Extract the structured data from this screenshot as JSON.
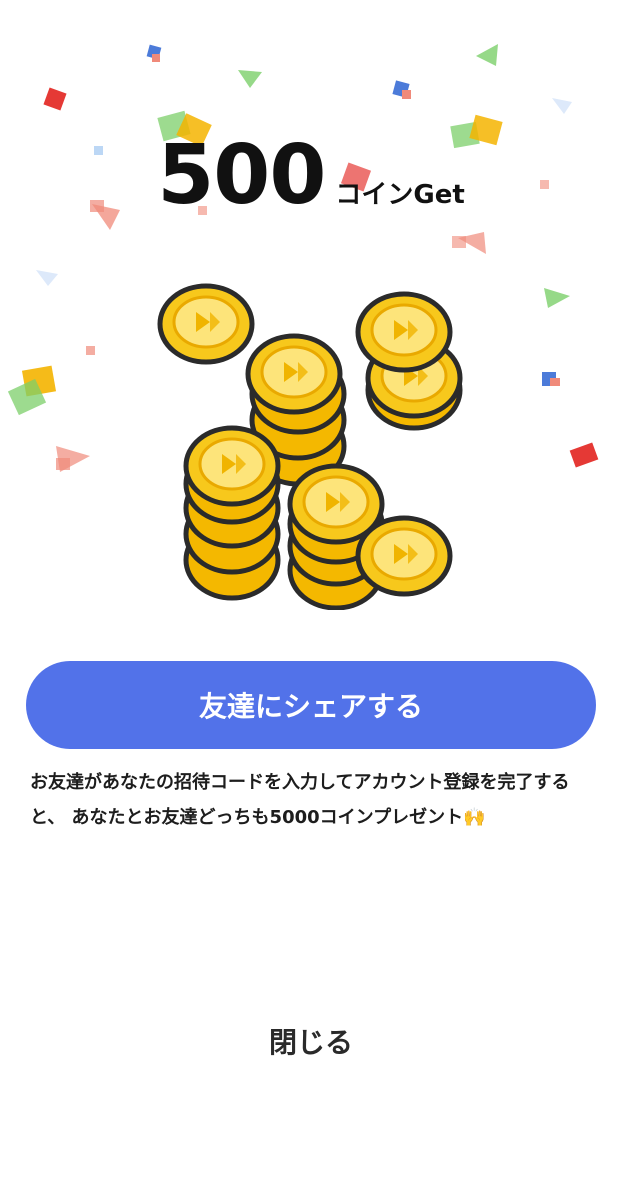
{
  "reward": {
    "amount": "500",
    "unit": "コインGet"
  },
  "illustration": {
    "icon": "gold-coin-stack-icon",
    "coin_color": "#f5c518"
  },
  "share_button": {
    "label": "友達にシェアする",
    "color": "#5272e9"
  },
  "description": {
    "text": "お友達があなたの招待コードを入力してアカウント登録を完了すると、 あなたとお友達どっちも5000コインプレゼント🙌"
  },
  "close_button": {
    "label": "閉じる"
  },
  "confetti_colors": [
    "#e53935",
    "#4c7bd9",
    "#7ccf6a",
    "#f4b400",
    "#f08a7a",
    "#bcd7f5"
  ]
}
